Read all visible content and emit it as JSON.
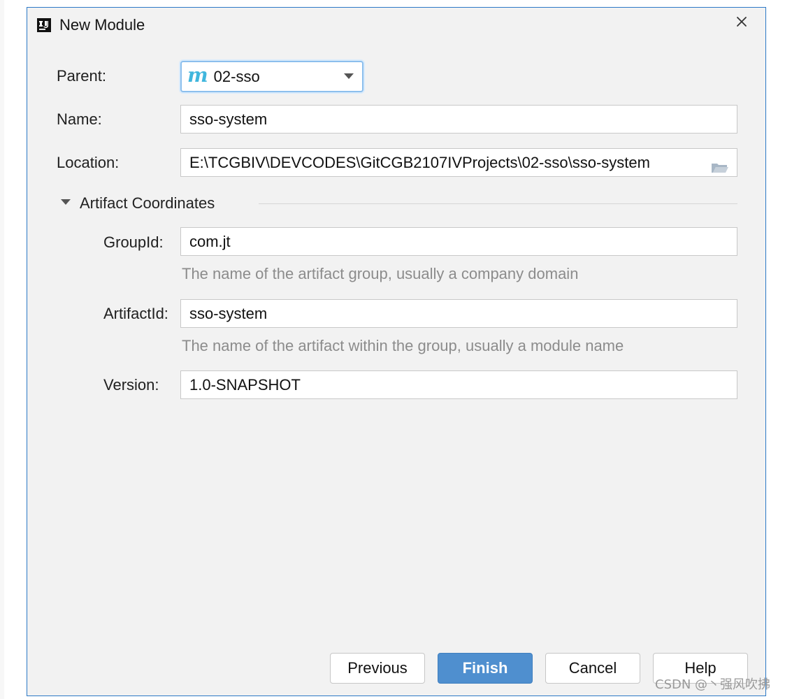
{
  "dialog": {
    "title": "New Module",
    "close_symbol": "×",
    "app_icon": "intellij-icon"
  },
  "form": {
    "parent": {
      "label": "Parent:",
      "value": "02-sso",
      "icon": "maven-module-icon",
      "icon_text": "m"
    },
    "name": {
      "label": "Name:",
      "value": "sso-system"
    },
    "location": {
      "label": "Location:",
      "value": "E:\\TCGBIV\\DEVCODES\\GitCGB2107IVProjects\\02-sso\\sso-system",
      "icon": "folder-icon"
    },
    "artifact_coordinates": {
      "label": "Artifact Coordinates",
      "groupId": {
        "label": "GroupId:",
        "value": "com.jt",
        "hint": "The name of the artifact group, usually a company domain"
      },
      "artifactId": {
        "label": "ArtifactId:",
        "value": "sso-system",
        "hint": "The name of the artifact within the group, usually a module name"
      },
      "version": {
        "label": "Version:",
        "value": "1.0-SNAPSHOT"
      }
    }
  },
  "buttons": {
    "previous": "Previous",
    "finish": "Finish",
    "cancel": "Cancel",
    "help": "Help"
  },
  "watermark": "CSDN @丶强风吹拂",
  "colors": {
    "dialog_border": "#2b78c6",
    "dialog_background": "#f2f2f2",
    "primary_button": "#4f8fcf",
    "maven_icon": "#40b6dd"
  }
}
